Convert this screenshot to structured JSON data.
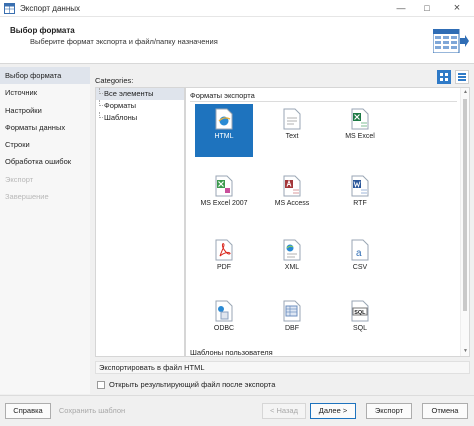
{
  "window": {
    "title": "Экспорт данных",
    "controls": [
      "minimize-icon",
      "maximize-icon",
      "close-icon"
    ]
  },
  "header": {
    "title": "Выбор формата",
    "subtitle": "Выберите формат экспорта и файл/папку назначения",
    "icon": "table-export-icon"
  },
  "sidebar": {
    "items": [
      {
        "label": "Выбор формата",
        "state": "active"
      },
      {
        "label": "Источник",
        "state": "normal"
      },
      {
        "label": "Настройки",
        "state": "normal"
      },
      {
        "label": "Форматы данных",
        "state": "normal"
      },
      {
        "label": "Строки",
        "state": "normal"
      },
      {
        "label": "Обработка ошибок",
        "state": "normal"
      },
      {
        "label": "Экспорт",
        "state": "disabled"
      },
      {
        "label": "Завершение",
        "state": "disabled"
      }
    ]
  },
  "main": {
    "categories_label": "Categories:",
    "view_buttons": [
      "large-icons-view-icon",
      "list-view-icon"
    ],
    "tree": [
      {
        "label": "Все элементы",
        "selected": true
      },
      {
        "label": "Форматы",
        "selected": false
      },
      {
        "label": "Шаблоны",
        "selected": false
      }
    ],
    "groups": {
      "formats_caption": "Форматы экспорта",
      "templates_caption": "Шаблоны пользователя"
    },
    "formats": [
      {
        "label": "HTML",
        "icon": "html-file-icon",
        "selected": true
      },
      {
        "label": "Text",
        "icon": "text-file-icon",
        "selected": false
      },
      {
        "label": "MS Excel",
        "icon": "excel-file-icon",
        "selected": false
      },
      {
        "label": "MS Excel 2007",
        "icon": "excel-2007-file-icon",
        "selected": false
      },
      {
        "label": "MS Access",
        "icon": "access-file-icon",
        "selected": false
      },
      {
        "label": "RTF",
        "icon": "rtf-file-icon",
        "selected": false
      },
      {
        "label": "PDF",
        "icon": "pdf-file-icon",
        "selected": false
      },
      {
        "label": "XML",
        "icon": "xml-file-icon",
        "selected": false
      },
      {
        "label": "CSV",
        "icon": "csv-file-icon",
        "selected": false
      },
      {
        "label": "ODBC",
        "icon": "odbc-file-icon",
        "selected": false
      },
      {
        "label": "DBF",
        "icon": "dbf-file-icon",
        "selected": false
      },
      {
        "label": "SQL",
        "icon": "sql-file-icon",
        "selected": false
      }
    ],
    "description": "Экспортировать в файл HTML",
    "open_after_export": {
      "label": "Открыть результирующий файл после экспорта",
      "checked": false
    }
  },
  "footer": {
    "help": "Справка",
    "save_template": "Сохранить шаблон",
    "back": "< Назад",
    "next": "Далее >",
    "export": "Экспорт",
    "cancel": "Отмена"
  },
  "colors": {
    "accent": "#1e73be",
    "sidebar_active": "#dfe4ec",
    "disabled_text": "#b8b8b8"
  }
}
